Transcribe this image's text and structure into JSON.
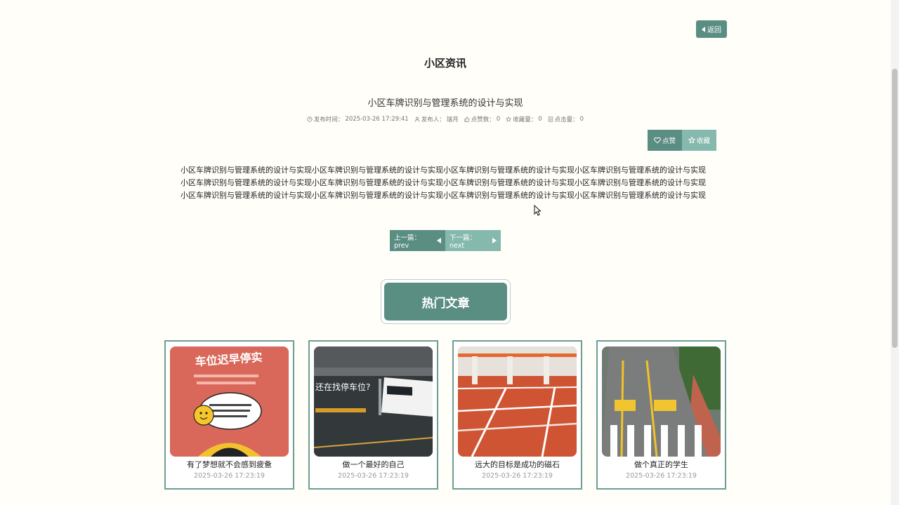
{
  "header": {
    "back_label": "返回",
    "section_title": "小区资讯"
  },
  "article": {
    "title": "小区车牌识别与管理系统的设计与实现",
    "meta": {
      "publish_label": "发布时间：",
      "publish_time": "2025-03-26 17:29:41",
      "publisher_label": "发布人：",
      "publisher": "瑞月",
      "likes_label": "点赞数：",
      "likes": "0",
      "favorites_label": "收藏量：",
      "favorites": "0",
      "clicks_label": "点击量：",
      "clicks": "0"
    },
    "like_label": "点赞",
    "favorite_label": "收藏",
    "content": "小区车牌识别与管理系统的设计与实现小区车牌识别与管理系统的设计与实现小区车牌识别与管理系统的设计与实现小区车牌识别与管理系统的设计与实现小区车牌识别与管理系统的设计与实现小区车牌识别与管理系统的设计与实现小区车牌识别与管理系统的设计与实现小区车牌识别与管理系统的设计与实现小区车牌识别与管理系统的设计与实现小区车牌识别与管理系统的设计与实现小区车牌识别与管理系统的设计与实现小区车牌识别与管理系统的设计与实现"
  },
  "pager": {
    "prev_label": "上一篇：prev",
    "next_label": "下一篇：next"
  },
  "hot": {
    "title": "热门文章",
    "items": [
      {
        "title": "有了梦想就不会感到疲惫",
        "date": "2025-03-26 17:23:19",
        "image_text": "车位迟早停实"
      },
      {
        "title": "做一个最好的自己",
        "date": "2025-03-26 17:23:19",
        "image_text": "还在找停车位?"
      },
      {
        "title": "远大的目标是成功的磁石",
        "date": "2025-03-26 17:23:19"
      },
      {
        "title": "做个真正的学生",
        "date": "2025-03-26 17:23:19"
      }
    ]
  },
  "colors": {
    "primary": "#5b8e83",
    "primary_light": "#86b9ad",
    "background": "#fffef9"
  }
}
